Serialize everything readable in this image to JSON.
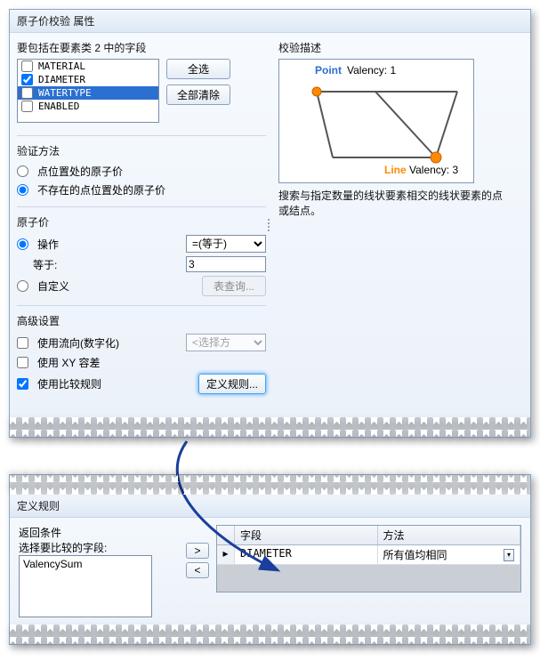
{
  "colors": {
    "accent": "#2b6fd1",
    "line_valency": "#ff8a00",
    "point_valency": "#555"
  },
  "window1": {
    "title": "原子价校验 属性",
    "fields_section": {
      "label": "要包括在要素类 2 中的字段",
      "items": [
        {
          "name": "MATERIAL",
          "checked": false,
          "selected": false
        },
        {
          "name": "DIAMETER",
          "checked": true,
          "selected": false
        },
        {
          "name": "WATERTYPE",
          "checked": false,
          "selected": true
        },
        {
          "name": "ENABLED",
          "checked": false,
          "selected": false
        }
      ],
      "select_all": "全选",
      "clear_all": "全部清除"
    },
    "validation": {
      "label": "验证方法",
      "opt1": "点位置处的原子价",
      "opt2": "不存在的点位置处的原子价",
      "selected": 2
    },
    "valency": {
      "label": "原子价",
      "op_label": "操作",
      "op_value": "=(等于)",
      "eq_label": "等于:",
      "eq_value": "3",
      "custom_label": "自定义",
      "table_query_btn": "表查询..."
    },
    "advanced": {
      "label": "高级设置",
      "flow": "使用流向(数字化)",
      "flow_dropdown": "<选择方",
      "xy": "使用 XY 容差",
      "compare": "使用比较规则",
      "compare_checked": true,
      "define_rules_btn": "定义规则..."
    }
  },
  "description": {
    "label": "校验描述",
    "point_label": "Point",
    "point_valency": "Valency: 1",
    "line_label": "Line",
    "line_valency": "Valency: 3",
    "help": "搜索与指定数量的线状要素相交的线状要素的点或结点。"
  },
  "window2": {
    "title": "定义规则",
    "return_label": "返回条件",
    "select_label": "选择要比较的字段:",
    "list_items": [
      "ValencySum"
    ],
    "move_right": ">",
    "move_left": "<",
    "grid": {
      "col_field": "字段",
      "col_method": "方法",
      "rows": [
        {
          "field": "DIAMETER",
          "method": "所有值均相同"
        }
      ]
    }
  }
}
